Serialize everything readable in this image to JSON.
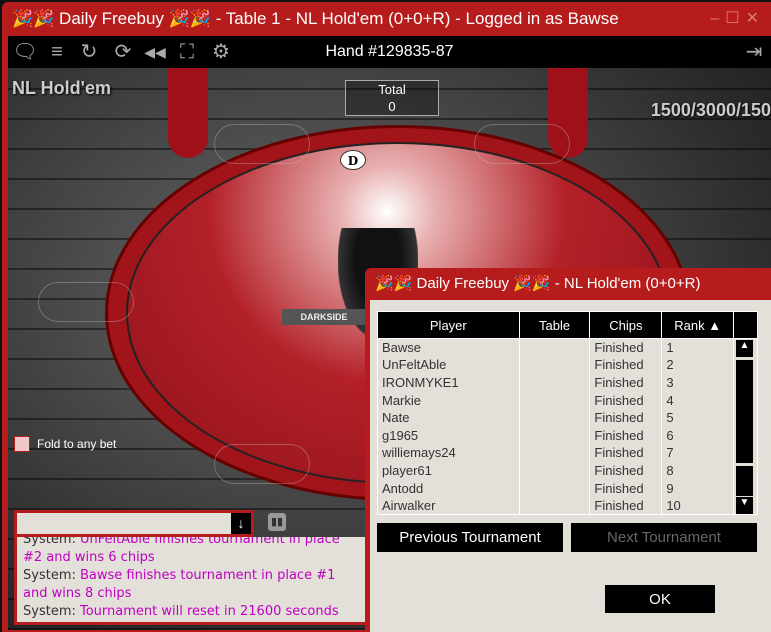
{
  "window": {
    "title": "🎉🎉 Daily Freebuy 🎉🎉 - Table 1 - NL Hold'em (0+0+R) - Logged in as Bawse",
    "controls": "–☐✕"
  },
  "toolbar": {
    "hand": "Hand #129835-87",
    "icons": [
      "chat-icon",
      "menu-icon",
      "refresh-icon",
      "rebuy-icon",
      "rewind-icon",
      "fullscreen-icon",
      "gear-icon",
      "exit-icon"
    ]
  },
  "game": {
    "type": "NL Hold'em",
    "blinds": "1500/3000/150",
    "total_label": "Total",
    "total_value": "0",
    "dealer": "D",
    "table_logo": "DARKSIDE",
    "fold_label": "Fold to any bet"
  },
  "chat": {
    "messages": [
      {
        "sender": "System:",
        "text": "UnFeltAble finishes tournament in place #2 and wins 6 chips"
      },
      {
        "sender": "System:",
        "text": "Bawse finishes tournament in place #1 and wins 8 chips"
      },
      {
        "sender": "System:",
        "text": "Tournament will reset in 21600 seconds"
      }
    ]
  },
  "dialog": {
    "title": "🎉🎉 Daily Freebuy 🎉🎉 - NL Hold'em (0+0+R)",
    "columns": [
      "Player",
      "Table",
      "Chips",
      "Rank ▲"
    ],
    "rows": [
      {
        "player": "Bawse",
        "table": "",
        "chips": "Finished",
        "rank": "1"
      },
      {
        "player": "UnFeltAble",
        "table": "",
        "chips": "Finished",
        "rank": "2"
      },
      {
        "player": "IRONMYKE1",
        "table": "",
        "chips": "Finished",
        "rank": "3"
      },
      {
        "player": "Markie",
        "table": "",
        "chips": "Finished",
        "rank": "4"
      },
      {
        "player": "Nate",
        "table": "",
        "chips": "Finished",
        "rank": "5"
      },
      {
        "player": "g1965",
        "table": "",
        "chips": "Finished",
        "rank": "6"
      },
      {
        "player": "williemays24",
        "table": "",
        "chips": "Finished",
        "rank": "7"
      },
      {
        "player": "player61",
        "table": "",
        "chips": "Finished",
        "rank": "8"
      },
      {
        "player": "Antodd",
        "table": "",
        "chips": "Finished",
        "rank": "9"
      },
      {
        "player": "Airwalker",
        "table": "",
        "chips": "Finished",
        "rank": "10"
      }
    ],
    "prev_label": "Previous Tournament",
    "next_label": "Next Tournament",
    "ok_label": "OK"
  },
  "colors": {
    "accent": "#b71c1c",
    "panel": "#e3dfd9",
    "chat_message": "#c000c0"
  }
}
